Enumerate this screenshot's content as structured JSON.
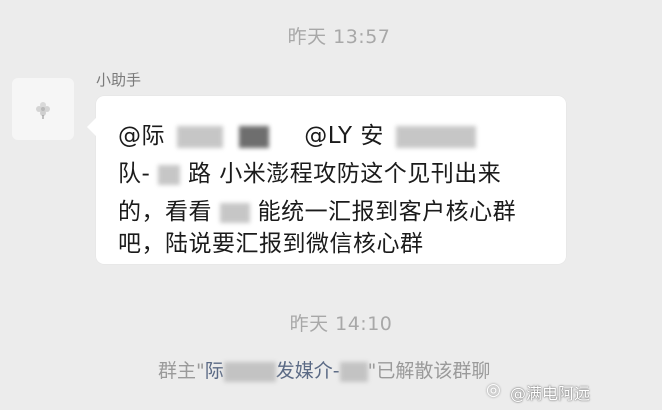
{
  "timestamps": {
    "first": "昨天 13:57",
    "second": "昨天 14:10"
  },
  "message": {
    "sender": "小助手",
    "lines": [
      "@际",
      "@LY 安",
      "队-",
      "路 小米澎程攻防这个见刊出来",
      "的，看看",
      "能统一汇报到客户核心群",
      "吧，陆说要汇报到微信核心群"
    ]
  },
  "notice": {
    "prefix": "群主\"",
    "name_start": "际",
    "name_end": "发媒介-",
    "suffix": "\"已解散该群聊"
  },
  "watermark": {
    "icon": "weibo-icon",
    "text": "@满电阿远"
  },
  "colors": {
    "background": "#ececec",
    "bubble": "#ffffff",
    "timestamp": "#a8a8a8",
    "notice_name": "#5b6a85"
  }
}
